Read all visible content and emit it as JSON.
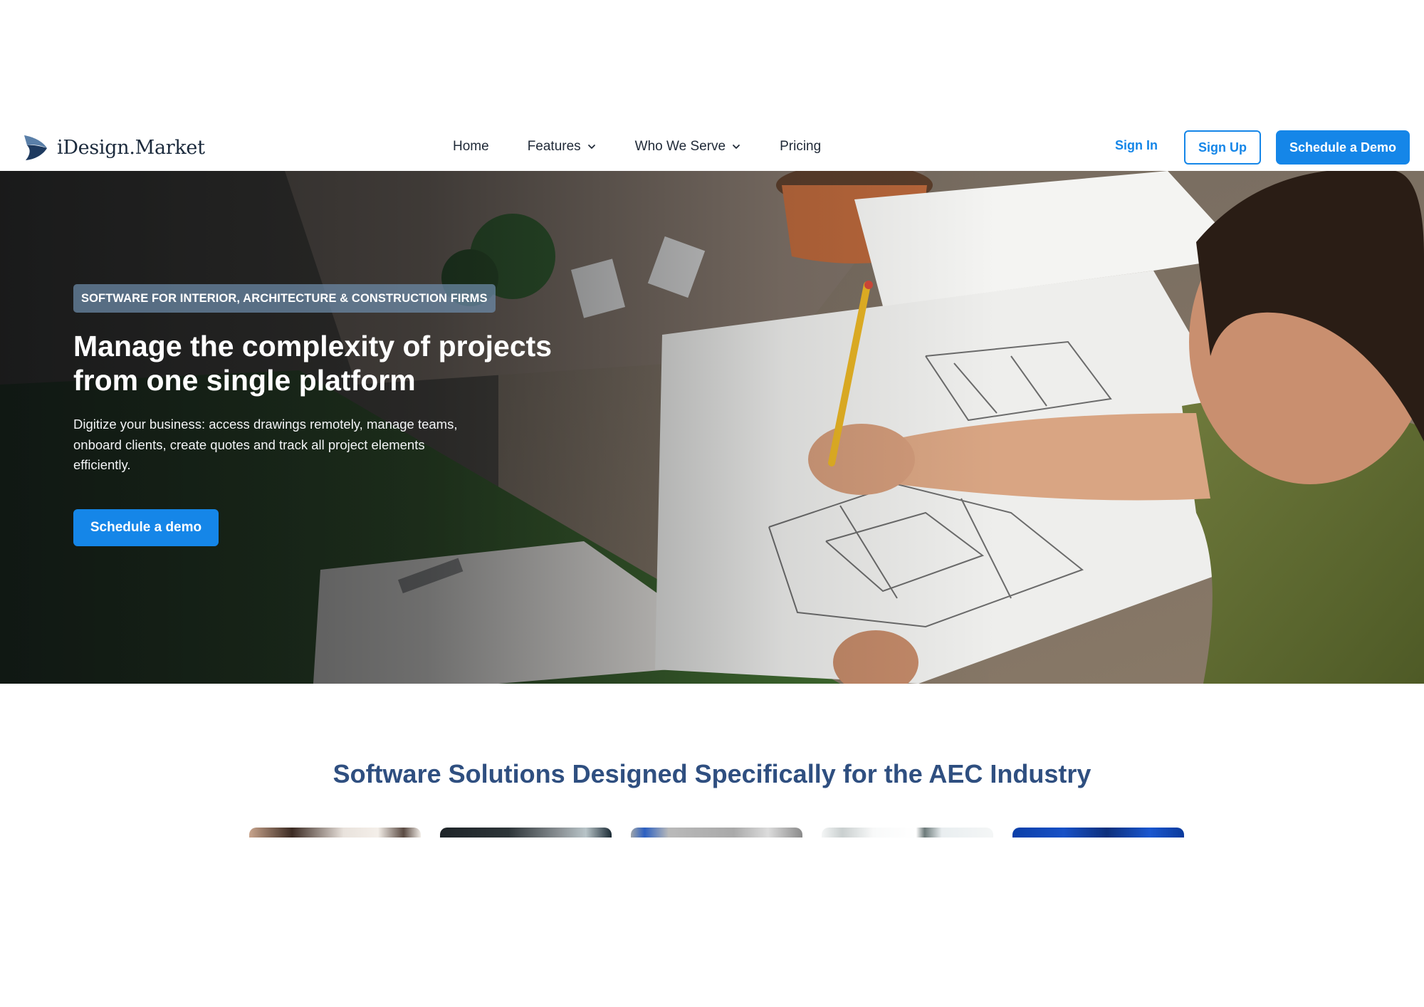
{
  "header": {
    "logo_text": "iDesign.Market",
    "nav": [
      {
        "label": "Home"
      },
      {
        "label": "Features"
      },
      {
        "label": "Who We Serve"
      },
      {
        "label": "Pricing"
      }
    ],
    "sign_in": "Sign In",
    "sign_up": "Sign Up",
    "schedule_demo": "Schedule a Demo"
  },
  "hero": {
    "badge": "SOFTWARE FOR INTERIOR, ARCHITECTURE & CONSTRUCTION FIRMS",
    "title": "Manage the complexity of projects from one single platform",
    "subtitle": "Digitize your business: access drawings remotely, manage teams, onboard clients, create quotes and track all project elements efficiently.",
    "cta": "Schedule a demo"
  },
  "solutions": {
    "title": "Software Solutions Designed Specifically for the AEC Industry",
    "cards": [
      {
        "icon": "photo-people"
      },
      {
        "icon": "photo-dark"
      },
      {
        "icon": "photo-grey"
      },
      {
        "icon": "photo-light"
      },
      {
        "icon": "photo-blue"
      }
    ]
  },
  "colors": {
    "accent": "#1586e8",
    "heading": "#2f4f80",
    "logo_text": "#1b2a3c"
  }
}
